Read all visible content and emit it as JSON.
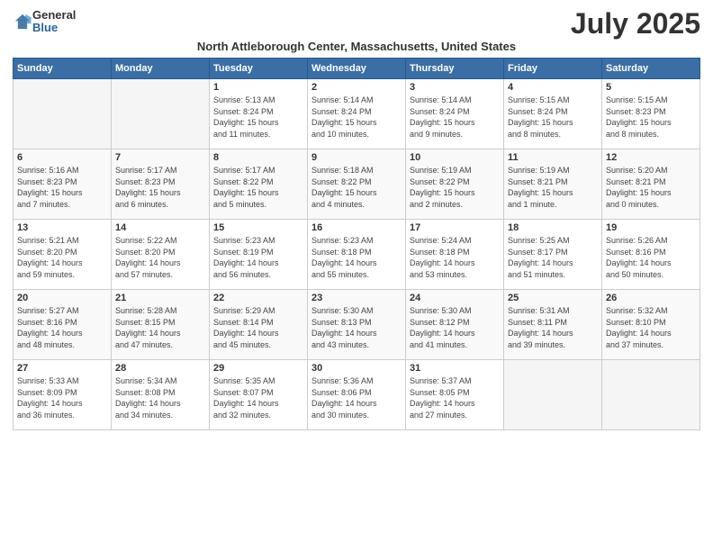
{
  "header": {
    "logo_general": "General",
    "logo_blue": "Blue",
    "month_year": "July 2025",
    "location": "North Attleborough Center, Massachusetts, United States"
  },
  "weekdays": [
    "Sunday",
    "Monday",
    "Tuesday",
    "Wednesday",
    "Thursday",
    "Friday",
    "Saturday"
  ],
  "weeks": [
    [
      {
        "day": "",
        "info": ""
      },
      {
        "day": "",
        "info": ""
      },
      {
        "day": "1",
        "info": "Sunrise: 5:13 AM\nSunset: 8:24 PM\nDaylight: 15 hours\nand 11 minutes."
      },
      {
        "day": "2",
        "info": "Sunrise: 5:14 AM\nSunset: 8:24 PM\nDaylight: 15 hours\nand 10 minutes."
      },
      {
        "day": "3",
        "info": "Sunrise: 5:14 AM\nSunset: 8:24 PM\nDaylight: 15 hours\nand 9 minutes."
      },
      {
        "day": "4",
        "info": "Sunrise: 5:15 AM\nSunset: 8:24 PM\nDaylight: 15 hours\nand 8 minutes."
      },
      {
        "day": "5",
        "info": "Sunrise: 5:15 AM\nSunset: 8:23 PM\nDaylight: 15 hours\nand 8 minutes."
      }
    ],
    [
      {
        "day": "6",
        "info": "Sunrise: 5:16 AM\nSunset: 8:23 PM\nDaylight: 15 hours\nand 7 minutes."
      },
      {
        "day": "7",
        "info": "Sunrise: 5:17 AM\nSunset: 8:23 PM\nDaylight: 15 hours\nand 6 minutes."
      },
      {
        "day": "8",
        "info": "Sunrise: 5:17 AM\nSunset: 8:22 PM\nDaylight: 15 hours\nand 5 minutes."
      },
      {
        "day": "9",
        "info": "Sunrise: 5:18 AM\nSunset: 8:22 PM\nDaylight: 15 hours\nand 4 minutes."
      },
      {
        "day": "10",
        "info": "Sunrise: 5:19 AM\nSunset: 8:22 PM\nDaylight: 15 hours\nand 2 minutes."
      },
      {
        "day": "11",
        "info": "Sunrise: 5:19 AM\nSunset: 8:21 PM\nDaylight: 15 hours\nand 1 minute."
      },
      {
        "day": "12",
        "info": "Sunrise: 5:20 AM\nSunset: 8:21 PM\nDaylight: 15 hours\nand 0 minutes."
      }
    ],
    [
      {
        "day": "13",
        "info": "Sunrise: 5:21 AM\nSunset: 8:20 PM\nDaylight: 14 hours\nand 59 minutes."
      },
      {
        "day": "14",
        "info": "Sunrise: 5:22 AM\nSunset: 8:20 PM\nDaylight: 14 hours\nand 57 minutes."
      },
      {
        "day": "15",
        "info": "Sunrise: 5:23 AM\nSunset: 8:19 PM\nDaylight: 14 hours\nand 56 minutes."
      },
      {
        "day": "16",
        "info": "Sunrise: 5:23 AM\nSunset: 8:18 PM\nDaylight: 14 hours\nand 55 minutes."
      },
      {
        "day": "17",
        "info": "Sunrise: 5:24 AM\nSunset: 8:18 PM\nDaylight: 14 hours\nand 53 minutes."
      },
      {
        "day": "18",
        "info": "Sunrise: 5:25 AM\nSunset: 8:17 PM\nDaylight: 14 hours\nand 51 minutes."
      },
      {
        "day": "19",
        "info": "Sunrise: 5:26 AM\nSunset: 8:16 PM\nDaylight: 14 hours\nand 50 minutes."
      }
    ],
    [
      {
        "day": "20",
        "info": "Sunrise: 5:27 AM\nSunset: 8:16 PM\nDaylight: 14 hours\nand 48 minutes."
      },
      {
        "day": "21",
        "info": "Sunrise: 5:28 AM\nSunset: 8:15 PM\nDaylight: 14 hours\nand 47 minutes."
      },
      {
        "day": "22",
        "info": "Sunrise: 5:29 AM\nSunset: 8:14 PM\nDaylight: 14 hours\nand 45 minutes."
      },
      {
        "day": "23",
        "info": "Sunrise: 5:30 AM\nSunset: 8:13 PM\nDaylight: 14 hours\nand 43 minutes."
      },
      {
        "day": "24",
        "info": "Sunrise: 5:30 AM\nSunset: 8:12 PM\nDaylight: 14 hours\nand 41 minutes."
      },
      {
        "day": "25",
        "info": "Sunrise: 5:31 AM\nSunset: 8:11 PM\nDaylight: 14 hours\nand 39 minutes."
      },
      {
        "day": "26",
        "info": "Sunrise: 5:32 AM\nSunset: 8:10 PM\nDaylight: 14 hours\nand 37 minutes."
      }
    ],
    [
      {
        "day": "27",
        "info": "Sunrise: 5:33 AM\nSunset: 8:09 PM\nDaylight: 14 hours\nand 36 minutes."
      },
      {
        "day": "28",
        "info": "Sunrise: 5:34 AM\nSunset: 8:08 PM\nDaylight: 14 hours\nand 34 minutes."
      },
      {
        "day": "29",
        "info": "Sunrise: 5:35 AM\nSunset: 8:07 PM\nDaylight: 14 hours\nand 32 minutes."
      },
      {
        "day": "30",
        "info": "Sunrise: 5:36 AM\nSunset: 8:06 PM\nDaylight: 14 hours\nand 30 minutes."
      },
      {
        "day": "31",
        "info": "Sunrise: 5:37 AM\nSunset: 8:05 PM\nDaylight: 14 hours\nand 27 minutes."
      },
      {
        "day": "",
        "info": ""
      },
      {
        "day": "",
        "info": ""
      }
    ]
  ]
}
